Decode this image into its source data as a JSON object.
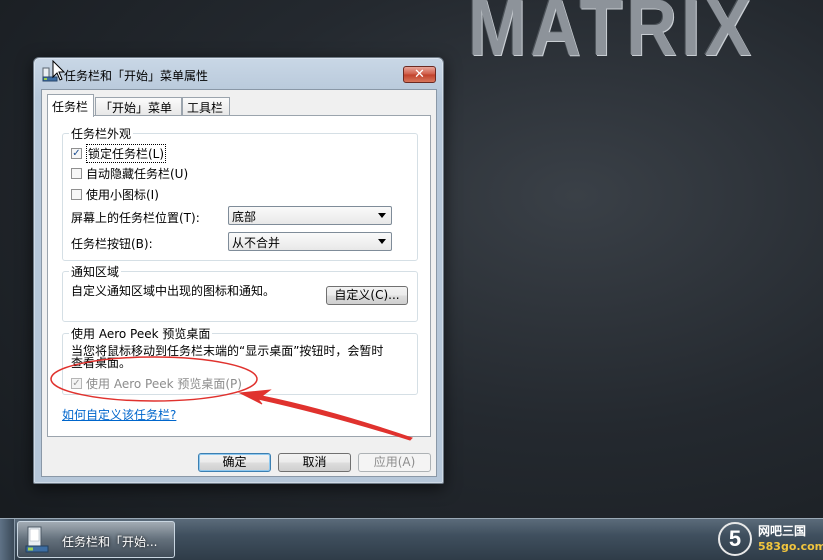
{
  "desktop": {
    "wallpaper_text": "MATRIX"
  },
  "dialog": {
    "title": "任务栏和「开始」菜单属性",
    "close_symbol": "✕",
    "tabs": [
      {
        "label": "任务栏",
        "active": true
      },
      {
        "label": "「开始」菜单",
        "active": false
      },
      {
        "label": "工具栏",
        "active": false
      }
    ],
    "appearance": {
      "title": "任务栏外观",
      "lock_taskbar": {
        "label": "锁定任务栏(L)",
        "checked": true
      },
      "auto_hide": {
        "label": "自动隐藏任务栏(U)",
        "checked": false
      },
      "small_icons": {
        "label": "使用小图标(I)",
        "checked": false
      },
      "location": {
        "label": "屏幕上的任务栏位置(T):",
        "value": "底部"
      },
      "buttons": {
        "label": "任务栏按钮(B):",
        "value": "从不合并"
      }
    },
    "notification": {
      "title": "通知区域",
      "description": "自定义通知区域中出现的图标和通知。",
      "customize_button": "自定义(C)..."
    },
    "aero_peek": {
      "title": "使用 Aero Peek 预览桌面",
      "description_line1": "当您将鼠标移动到任务栏末端的“显示桌面”按钮时，会暂时",
      "description_line2": "查看桌面。",
      "checkbox": {
        "label": "使用 Aero Peek 预览桌面(P)",
        "checked": true,
        "disabled": true
      }
    },
    "help_link": "如何自定义该任务栏?",
    "ok_button": "确定",
    "cancel_button": "取消",
    "apply_button": "应用(A)"
  },
  "taskbar": {
    "active_window_label": "任务栏和「开始...",
    "watermark_digit": "5",
    "watermark_name": "网吧三国",
    "watermark_url": "583go.com"
  },
  "colors": {
    "annotation_red": "#e0322e",
    "link_blue": "#0066cc"
  }
}
